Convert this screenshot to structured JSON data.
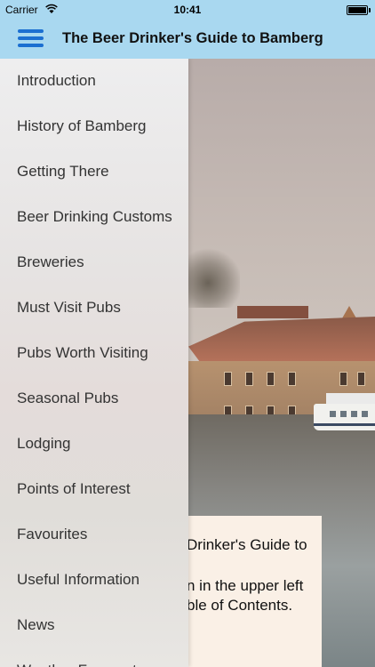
{
  "status": {
    "carrier": "Carrier",
    "time": "10:41"
  },
  "nav": {
    "title": "The Beer Drinker's Guide to Bamberg"
  },
  "menu": {
    "items": [
      "Introduction",
      "History of Bamberg",
      "Getting There",
      "Beer Drinking Customs",
      "Breweries",
      "Must Visit Pubs",
      "Pubs Worth Visiting",
      "Seasonal Pubs",
      "Lodging",
      "Points of Interest",
      "Favourites",
      "Useful Information",
      "News",
      "Weather Forecast"
    ]
  },
  "content": {
    "line1": "Drinker's Guide to",
    "line2": "n in the upper left",
    "line3": "ble of Contents."
  },
  "colors": {
    "navbar": "#a9d8f0",
    "menu_icon": "#1b6fd1",
    "card": "#faf0e6"
  }
}
